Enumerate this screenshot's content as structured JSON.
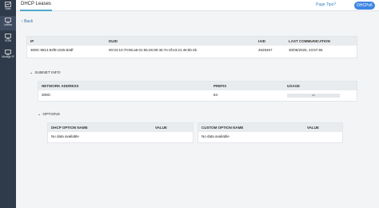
{
  "sidebar": {
    "items": [
      {
        "label": "Stats",
        "icon": "stats-icon"
      },
      {
        "label": "Leases",
        "icon": "leases-icon",
        "active": true
      },
      {
        "label": "VLAN",
        "icon": "vlan-icon"
      },
      {
        "label": "Manage IP",
        "icon": "manage-ip-icon"
      }
    ]
  },
  "header": {
    "title": "DHCP Leases",
    "tips_link": "Page Tips?",
    "button_label": "DHCPv6"
  },
  "back_label": "Back",
  "lease_table": {
    "headers": [
      "IP",
      "DUID",
      "IAID",
      "LAST COMMUNICATION"
    ],
    "row": [
      "3000::9814:84f9:c025:83df",
      "00:04:10:70:85:a6:01:55:26:90:46:7e:3f:e3:21:46:5b:4b",
      "4628467",
      "30/05/2025, 23:57:55"
    ]
  },
  "subnet_info": {
    "title": "SUBNET INFO",
    "headers": [
      "NETWORK ADDRESS",
      "PREFIX",
      "USAGE"
    ],
    "row": [
      "3000::",
      "64",
      "0%"
    ]
  },
  "options": {
    "title": "OPTIONS",
    "dhcp_headers": [
      "DHCP OPTION NAME",
      "VALUE"
    ],
    "dhcp_empty": "No data available",
    "custom_headers": [
      "CUSTOM OPTION NAME",
      "VALUE"
    ],
    "custom_empty": "No data available"
  }
}
